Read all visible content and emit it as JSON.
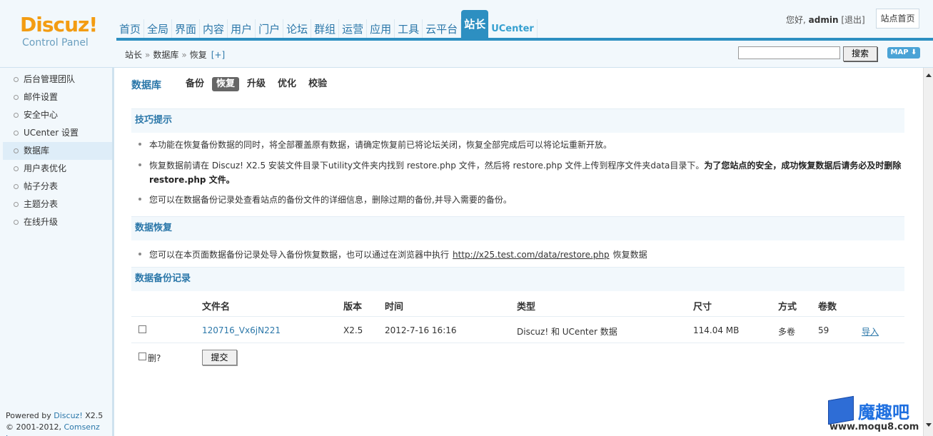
{
  "header": {
    "logo_brand": "Discuz!",
    "logo_sub": "Control Panel",
    "nav": [
      {
        "label": "首页",
        "active": false
      },
      {
        "label": "全局",
        "active": false
      },
      {
        "label": "界面",
        "active": false
      },
      {
        "label": "内容",
        "active": false
      },
      {
        "label": "用户",
        "active": false
      },
      {
        "label": "门户",
        "active": false
      },
      {
        "label": "论坛",
        "active": false
      },
      {
        "label": "群组",
        "active": false
      },
      {
        "label": "运营",
        "active": false
      },
      {
        "label": "应用",
        "active": false
      },
      {
        "label": "工具",
        "active": false
      },
      {
        "label": "云平台",
        "active": false
      },
      {
        "label": "站长",
        "active": true
      },
      {
        "label": "UCenter",
        "active": false
      }
    ],
    "greeting": "您好,",
    "username": "admin",
    "logout": "[退出]",
    "site_home": "站点首页",
    "breadcrumb": [
      "站长",
      "数据库",
      "恢复"
    ],
    "breadcrumb_sep": "»",
    "breadcrumb_plus": "[+]",
    "search_button": "搜索",
    "search_value": "",
    "map_button": "MAP ⬇"
  },
  "sidebar": {
    "items": [
      {
        "label": "后台管理团队",
        "active": false
      },
      {
        "label": "邮件设置",
        "active": false
      },
      {
        "label": "安全中心",
        "active": false
      },
      {
        "label": "UCenter 设置",
        "active": false
      },
      {
        "label": "数据库",
        "active": true
      },
      {
        "label": "用户表优化",
        "active": false
      },
      {
        "label": "帖子分表",
        "active": false
      },
      {
        "label": "主题分表",
        "active": false
      },
      {
        "label": "在线升级",
        "active": false
      }
    ],
    "footer_powered": "Powered by",
    "footer_discuz": "Discuz!",
    "footer_version": "X2.5",
    "footer_copy": "© 2001-2012,",
    "footer_company": "Comsenz Inc."
  },
  "main": {
    "page_title": "数据库",
    "tabs": [
      {
        "label": "备份",
        "active": false
      },
      {
        "label": "恢复",
        "active": true
      },
      {
        "label": "升级",
        "active": false
      },
      {
        "label": "优化",
        "active": false
      },
      {
        "label": "校验",
        "active": false
      }
    ],
    "tips_title": "技巧提示",
    "tips": {
      "tip1": "本功能在恢复备份数据的同时，将全部覆盖原有数据，请确定恢复前已将论坛关闭，恢复全部完成后可以将论坛重新开放。",
      "tip2_a": "恢复数据前请在 Discuz! X2.5 安装文件目录下utility文件夹内找到 restore.php 文件，然后将 restore.php 文件上传到程序文件夹data目录下。",
      "tip2_b": "为了您站点的安全，成功恢复数据后请务必及时删除 restore.php 文件。",
      "tip3": "您可以在数据备份记录处查看站点的备份文件的详细信息，删除过期的备份,并导入需要的备份。"
    },
    "restore_title": "数据恢复",
    "restore_tip_a": "您可以在本页面数据备份记录处导入备份恢复数据，也可以通过在浏览器中执行",
    "restore_url": "http://x25.test.com/data/restore.php",
    "restore_tip_b": "恢复数据",
    "records_title": "数据备份记录",
    "table": {
      "headers": {
        "filename": "文件名",
        "version": "版本",
        "time": "时间",
        "type": "类型",
        "size": "尺寸",
        "method": "方式",
        "volumes": "卷数"
      },
      "rows": [
        {
          "filename": "120716_Vx6jN221",
          "version": "X2.5",
          "time": "2012-7-16 16:16",
          "type": "Discuz! 和 UCenter 数据",
          "size": "114.04 MB",
          "method": "多卷",
          "volumes": "59",
          "action": "导入"
        }
      ]
    },
    "delete_label": "删?",
    "submit_button": "提交"
  },
  "watermark": {
    "text": "魔趣吧",
    "url": "www.moqu8.com"
  }
}
